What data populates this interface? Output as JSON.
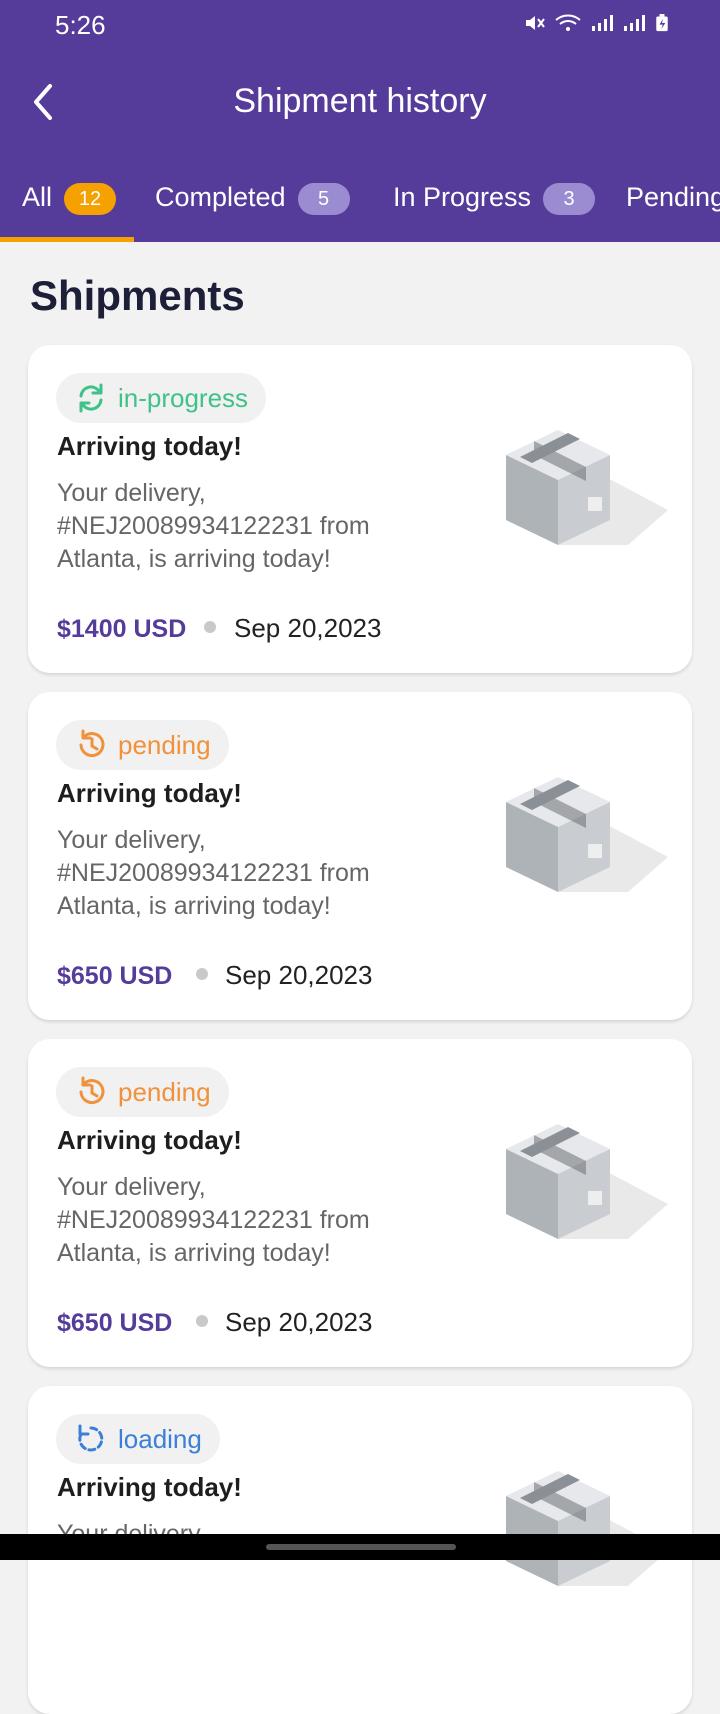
{
  "status_bar": {
    "time": "5:26"
  },
  "header": {
    "title": "Shipment history"
  },
  "tabs": [
    {
      "label": "All",
      "count": "12",
      "active": true
    },
    {
      "label": "Completed",
      "count": "5",
      "active": false
    },
    {
      "label": "In Progress",
      "count": "3",
      "active": false
    },
    {
      "label": "Pending",
      "count": "",
      "active": false
    }
  ],
  "section_title": "Shipments",
  "colors": {
    "primary": "#553c9a",
    "accent": "#f5a100",
    "in_progress": "#3ec28a",
    "pending": "#f0913b",
    "loading": "#3c7fd6"
  },
  "shipments": [
    {
      "status": "in-progress",
      "status_icon": "sync-icon",
      "title": "Arriving today!",
      "desc": "Your delivery, #NEJ20089934122231 from Atlanta, is arriving today!",
      "price": "$1400 USD",
      "date": "Sep 20,2023"
    },
    {
      "status": "pending",
      "status_icon": "history-icon",
      "title": "Arriving today!",
      "desc": "Your delivery, #NEJ20089934122231 from Atlanta, is arriving today!",
      "price": "$650 USD",
      "date": "Sep 20,2023"
    },
    {
      "status": "pending",
      "status_icon": "history-icon",
      "title": "Arriving today!",
      "desc": "Your delivery, #NEJ20089934122231 from Atlanta, is arriving today!",
      "price": "$650 USD",
      "date": "Sep 20,2023"
    },
    {
      "status": "loading",
      "status_icon": "loading-icon",
      "title": "Arriving today!",
      "desc": "Your delivery,",
      "price": "",
      "date": ""
    }
  ]
}
